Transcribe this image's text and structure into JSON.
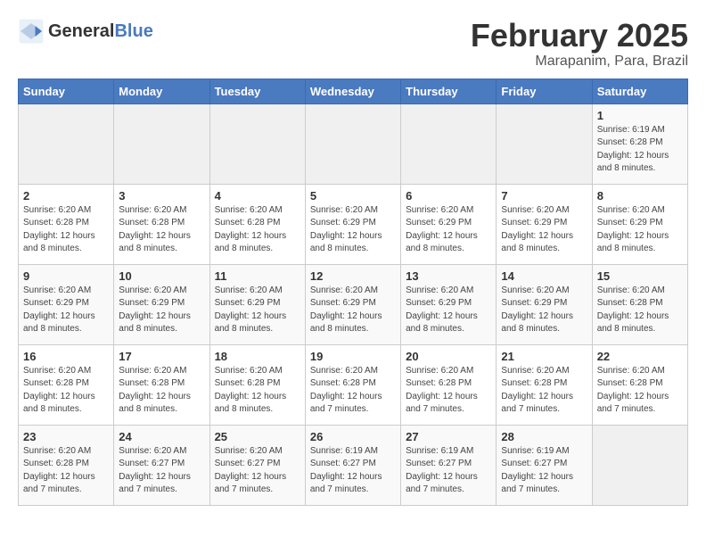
{
  "logo": {
    "text_general": "General",
    "text_blue": "Blue"
  },
  "header": {
    "title": "February 2025",
    "subtitle": "Marapanim, Para, Brazil"
  },
  "days_of_week": [
    "Sunday",
    "Monday",
    "Tuesday",
    "Wednesday",
    "Thursday",
    "Friday",
    "Saturday"
  ],
  "weeks": [
    [
      {
        "day": "",
        "info": ""
      },
      {
        "day": "",
        "info": ""
      },
      {
        "day": "",
        "info": ""
      },
      {
        "day": "",
        "info": ""
      },
      {
        "day": "",
        "info": ""
      },
      {
        "day": "",
        "info": ""
      },
      {
        "day": "1",
        "info": "Sunrise: 6:19 AM\nSunset: 6:28 PM\nDaylight: 12 hours\nand 8 minutes."
      }
    ],
    [
      {
        "day": "2",
        "info": "Sunrise: 6:20 AM\nSunset: 6:28 PM\nDaylight: 12 hours\nand 8 minutes."
      },
      {
        "day": "3",
        "info": "Sunrise: 6:20 AM\nSunset: 6:28 PM\nDaylight: 12 hours\nand 8 minutes."
      },
      {
        "day": "4",
        "info": "Sunrise: 6:20 AM\nSunset: 6:28 PM\nDaylight: 12 hours\nand 8 minutes."
      },
      {
        "day": "5",
        "info": "Sunrise: 6:20 AM\nSunset: 6:29 PM\nDaylight: 12 hours\nand 8 minutes."
      },
      {
        "day": "6",
        "info": "Sunrise: 6:20 AM\nSunset: 6:29 PM\nDaylight: 12 hours\nand 8 minutes."
      },
      {
        "day": "7",
        "info": "Sunrise: 6:20 AM\nSunset: 6:29 PM\nDaylight: 12 hours\nand 8 minutes."
      },
      {
        "day": "8",
        "info": "Sunrise: 6:20 AM\nSunset: 6:29 PM\nDaylight: 12 hours\nand 8 minutes."
      }
    ],
    [
      {
        "day": "9",
        "info": "Sunrise: 6:20 AM\nSunset: 6:29 PM\nDaylight: 12 hours\nand 8 minutes."
      },
      {
        "day": "10",
        "info": "Sunrise: 6:20 AM\nSunset: 6:29 PM\nDaylight: 12 hours\nand 8 minutes."
      },
      {
        "day": "11",
        "info": "Sunrise: 6:20 AM\nSunset: 6:29 PM\nDaylight: 12 hours\nand 8 minutes."
      },
      {
        "day": "12",
        "info": "Sunrise: 6:20 AM\nSunset: 6:29 PM\nDaylight: 12 hours\nand 8 minutes."
      },
      {
        "day": "13",
        "info": "Sunrise: 6:20 AM\nSunset: 6:29 PM\nDaylight: 12 hours\nand 8 minutes."
      },
      {
        "day": "14",
        "info": "Sunrise: 6:20 AM\nSunset: 6:29 PM\nDaylight: 12 hours\nand 8 minutes."
      },
      {
        "day": "15",
        "info": "Sunrise: 6:20 AM\nSunset: 6:28 PM\nDaylight: 12 hours\nand 8 minutes."
      }
    ],
    [
      {
        "day": "16",
        "info": "Sunrise: 6:20 AM\nSunset: 6:28 PM\nDaylight: 12 hours\nand 8 minutes."
      },
      {
        "day": "17",
        "info": "Sunrise: 6:20 AM\nSunset: 6:28 PM\nDaylight: 12 hours\nand 8 minutes."
      },
      {
        "day": "18",
        "info": "Sunrise: 6:20 AM\nSunset: 6:28 PM\nDaylight: 12 hours\nand 8 minutes."
      },
      {
        "day": "19",
        "info": "Sunrise: 6:20 AM\nSunset: 6:28 PM\nDaylight: 12 hours\nand 7 minutes."
      },
      {
        "day": "20",
        "info": "Sunrise: 6:20 AM\nSunset: 6:28 PM\nDaylight: 12 hours\nand 7 minutes."
      },
      {
        "day": "21",
        "info": "Sunrise: 6:20 AM\nSunset: 6:28 PM\nDaylight: 12 hours\nand 7 minutes."
      },
      {
        "day": "22",
        "info": "Sunrise: 6:20 AM\nSunset: 6:28 PM\nDaylight: 12 hours\nand 7 minutes."
      }
    ],
    [
      {
        "day": "23",
        "info": "Sunrise: 6:20 AM\nSunset: 6:28 PM\nDaylight: 12 hours\nand 7 minutes."
      },
      {
        "day": "24",
        "info": "Sunrise: 6:20 AM\nSunset: 6:27 PM\nDaylight: 12 hours\nand 7 minutes."
      },
      {
        "day": "25",
        "info": "Sunrise: 6:20 AM\nSunset: 6:27 PM\nDaylight: 12 hours\nand 7 minutes."
      },
      {
        "day": "26",
        "info": "Sunrise: 6:19 AM\nSunset: 6:27 PM\nDaylight: 12 hours\nand 7 minutes."
      },
      {
        "day": "27",
        "info": "Sunrise: 6:19 AM\nSunset: 6:27 PM\nDaylight: 12 hours\nand 7 minutes."
      },
      {
        "day": "28",
        "info": "Sunrise: 6:19 AM\nSunset: 6:27 PM\nDaylight: 12 hours\nand 7 minutes."
      },
      {
        "day": "",
        "info": ""
      }
    ]
  ]
}
